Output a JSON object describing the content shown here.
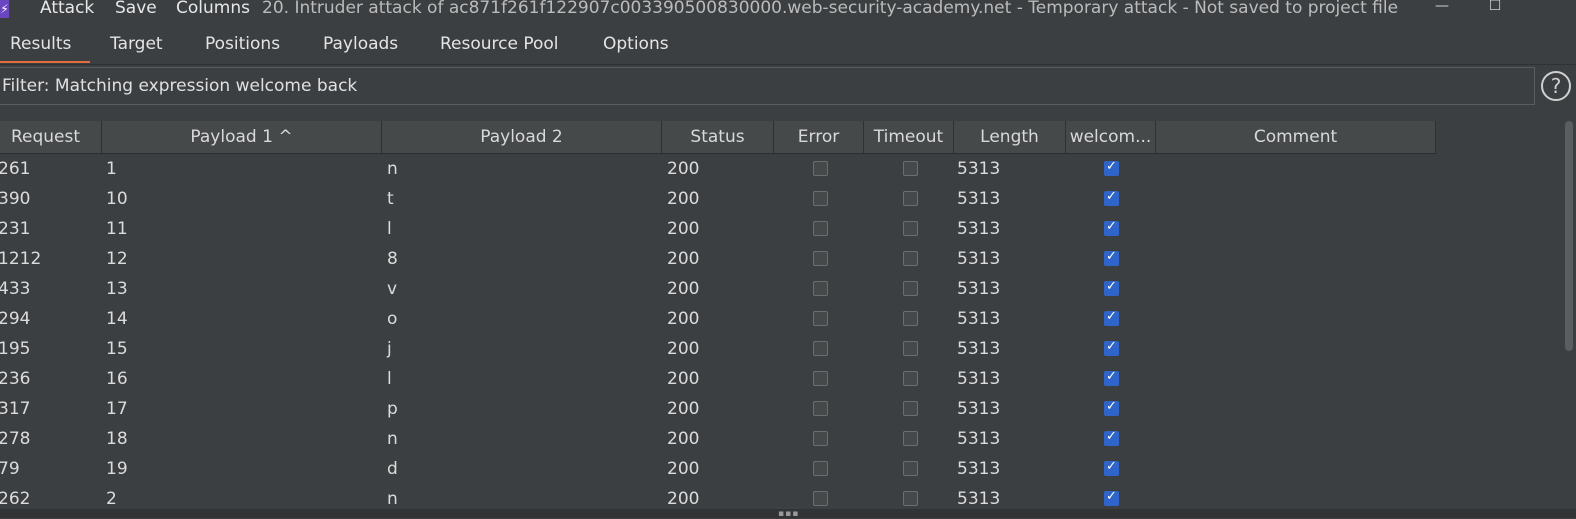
{
  "menu": {
    "attack": "Attack",
    "save": "Save",
    "columns": "Columns"
  },
  "window": {
    "title": "20. Intruder attack of ac871f261f122907c003390500830000.web-security-academy.net - Temporary attack - Not saved to project file",
    "minimize_glyph": "—",
    "maximize_glyph": "☐"
  },
  "tabs": [
    {
      "label": "Results",
      "active": true
    },
    {
      "label": "Target"
    },
    {
      "label": "Positions"
    },
    {
      "label": "Payloads"
    },
    {
      "label": "Resource Pool"
    },
    {
      "label": "Options"
    }
  ],
  "filter": {
    "text": "Filter: Matching expression welcome back"
  },
  "help_glyph": "?",
  "table": {
    "columns": [
      "Request",
      "Payload 1 ^",
      "Payload 2",
      "Status",
      "Error",
      "Timeout",
      "Length",
      "welcom...",
      "Comment"
    ],
    "rows": [
      {
        "request": "261",
        "p1": "1",
        "p2": "n",
        "status": "200",
        "error": false,
        "timeout": false,
        "length": "5313",
        "welcome": true
      },
      {
        "request": "390",
        "p1": "10",
        "p2": "t",
        "status": "200",
        "error": false,
        "timeout": false,
        "length": "5313",
        "welcome": true
      },
      {
        "request": "231",
        "p1": "11",
        "p2": "l",
        "status": "200",
        "error": false,
        "timeout": false,
        "length": "5313",
        "welcome": true
      },
      {
        "request": "1212",
        "p1": "12",
        "p2": "8",
        "status": "200",
        "error": false,
        "timeout": false,
        "length": "5313",
        "welcome": true
      },
      {
        "request": "433",
        "p1": "13",
        "p2": "v",
        "status": "200",
        "error": false,
        "timeout": false,
        "length": "5313",
        "welcome": true
      },
      {
        "request": "294",
        "p1": "14",
        "p2": "o",
        "status": "200",
        "error": false,
        "timeout": false,
        "length": "5313",
        "welcome": true
      },
      {
        "request": "195",
        "p1": "15",
        "p2": "j",
        "status": "200",
        "error": false,
        "timeout": false,
        "length": "5313",
        "welcome": true
      },
      {
        "request": "236",
        "p1": "16",
        "p2": "l",
        "status": "200",
        "error": false,
        "timeout": false,
        "length": "5313",
        "welcome": true
      },
      {
        "request": "317",
        "p1": "17",
        "p2": "p",
        "status": "200",
        "error": false,
        "timeout": false,
        "length": "5313",
        "welcome": true
      },
      {
        "request": "278",
        "p1": "18",
        "p2": "n",
        "status": "200",
        "error": false,
        "timeout": false,
        "length": "5313",
        "welcome": true
      },
      {
        "request": "79",
        "p1": "19",
        "p2": "d",
        "status": "200",
        "error": false,
        "timeout": false,
        "length": "5313",
        "welcome": true
      },
      {
        "request": "262",
        "p1": "2",
        "p2": "n",
        "status": "200",
        "error": false,
        "timeout": false,
        "length": "5313",
        "welcome": true
      }
    ]
  },
  "colors": {
    "accent_tab": "#e36d3a",
    "checkbox_checked": "#2f65ca",
    "background": "#3c3f41"
  }
}
